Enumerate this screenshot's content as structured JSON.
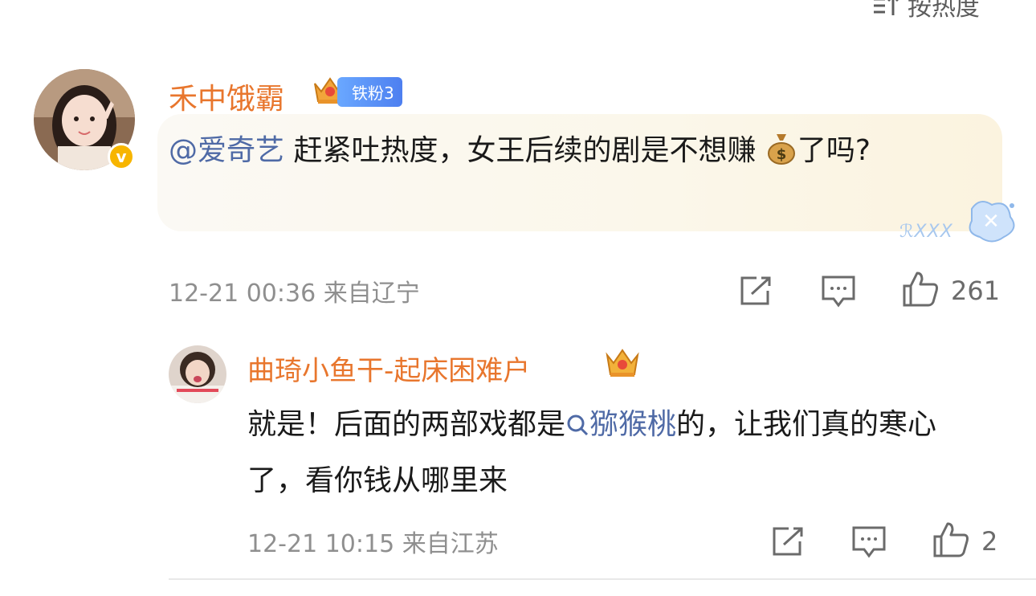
{
  "sort": {
    "label": "按热度",
    "icon": "sort-icon"
  },
  "comments": [
    {
      "user": {
        "name": "禾中饿霸",
        "badge_text": "铁粉3",
        "verified": true
      },
      "mention": "@爱奇艺",
      "text_before_emoji": " 赶紧吐热度，女王后续的剧是不想赚",
      "emoji": "money-bag-icon",
      "text_after_emoji": "了吗?",
      "decoration_text": "ℛXXX",
      "time": "12-21 00:36",
      "location": "来自辽宁",
      "likes": "261"
    }
  ],
  "reply": {
    "user": {
      "name": "曲琦小鱼干-起床困难户"
    },
    "text_before_topic": "就是！后面的两部戏都是",
    "topic": "猕猴桃",
    "text_after_topic": "的，让我们真的寒心了，看你钱从哪里来",
    "time": "12-21 10:15",
    "location": "来自江苏",
    "likes": "2"
  },
  "colors": {
    "username": "#e8762d",
    "link": "#4f6aa6",
    "meta": "#8f8f8f",
    "bubble": "#fbf7ea",
    "badge": "#4d7ff0"
  }
}
